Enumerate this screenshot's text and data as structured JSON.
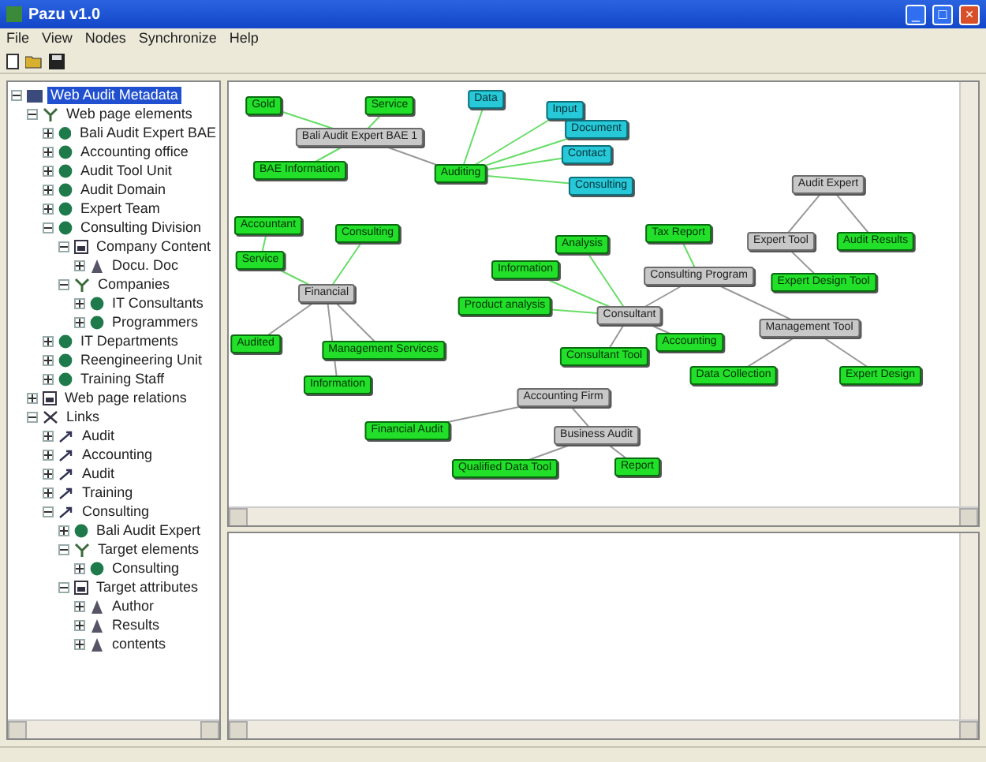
{
  "window": {
    "title": "Pazu v1.0",
    "controls": [
      "_",
      "□",
      "×"
    ]
  },
  "menu": [
    "File",
    "View",
    "Nodes",
    "Synchronize",
    "Help"
  ],
  "tree": [
    {
      "label": "Web Audit Metadata",
      "kind": "root",
      "selected": true,
      "expanded": true,
      "children": [
        {
          "label": "Web page elements",
          "kind": "type",
          "selected": false,
          "expanded": true,
          "children": [
            {
              "label": "Bali Audit Expert BAE",
              "kind": "entity",
              "selected": false,
              "expanded": false
            },
            {
              "label": "Accounting office",
              "kind": "entity",
              "selected": false,
              "expanded": false
            },
            {
              "label": "Audit Tool Unit",
              "kind": "entity",
              "selected": false,
              "expanded": false
            },
            {
              "label": "Audit Domain",
              "kind": "entity",
              "selected": false,
              "expanded": false
            },
            {
              "label": "Expert Team",
              "kind": "entity",
              "selected": false,
              "expanded": false
            },
            {
              "label": "Consulting Division",
              "kind": "entity",
              "selected": false,
              "expanded": true,
              "children": [
                {
                  "label": "Company Content",
                  "kind": "group",
                  "selected": false,
                  "expanded": true,
                  "children": [
                    {
                      "label": "Docu. Doc",
                      "kind": "attr",
                      "selected": false,
                      "expanded": false
                    }
                  ]
                },
                {
                  "label": "Companies",
                  "kind": "type",
                  "selected": false,
                  "expanded": true,
                  "children": [
                    {
                      "label": "IT Consultants",
                      "kind": "entity",
                      "selected": false,
                      "expanded": false
                    },
                    {
                      "label": "Programmers",
                      "kind": "entity",
                      "selected": false,
                      "expanded": false
                    }
                  ]
                }
              ]
            },
            {
              "label": "IT Departments",
              "kind": "entity",
              "selected": false,
              "expanded": false
            },
            {
              "label": "Reengineering Unit",
              "kind": "entity",
              "selected": false,
              "expanded": false
            },
            {
              "label": "Training Staff",
              "kind": "entity",
              "selected": false,
              "expanded": false
            }
          ]
        },
        {
          "label": "Web page relations",
          "kind": "group",
          "selected": false,
          "expanded": false
        },
        {
          "label": "Links",
          "kind": "links",
          "selected": false,
          "expanded": true,
          "children": [
            {
              "label": "Audit",
              "kind": "link",
              "selected": false,
              "expanded": false
            },
            {
              "label": "Accounting",
              "kind": "link",
              "selected": false,
              "expanded": false
            },
            {
              "label": "Audit",
              "kind": "link",
              "selected": false,
              "expanded": false
            },
            {
              "label": "Training",
              "kind": "link",
              "selected": false,
              "expanded": false
            },
            {
              "label": "Consulting",
              "kind": "link",
              "selected": false,
              "expanded": true,
              "children": [
                {
                  "label": "Bali Audit Expert",
                  "kind": "entity",
                  "selected": false,
                  "expanded": false
                },
                {
                  "label": "Target elements",
                  "kind": "type",
                  "selected": false,
                  "expanded": true,
                  "children": [
                    {
                      "label": "Consulting",
                      "kind": "entity",
                      "selected": false,
                      "expanded": false
                    }
                  ]
                },
                {
                  "label": "Target attributes",
                  "kind": "group",
                  "selected": false,
                  "expanded": true,
                  "children": [
                    {
                      "label": "Author",
                      "kind": "attr",
                      "selected": false,
                      "expanded": false
                    },
                    {
                      "label": "Results",
                      "kind": "attr",
                      "selected": false,
                      "expanded": false
                    },
                    {
                      "label": "contents",
                      "kind": "attr",
                      "selected": false,
                      "expanded": false
                    }
                  ]
                }
              ]
            }
          ]
        }
      ]
    }
  ],
  "graph": {
    "nodes": [
      {
        "label": "Gold",
        "kind": "element"
      },
      {
        "label": "Service",
        "kind": "element"
      },
      {
        "label": "Bali Audit Expert BAE 1",
        "kind": "class"
      },
      {
        "label": "BAE Information",
        "kind": "element"
      },
      {
        "label": "Auditing",
        "kind": "element"
      },
      {
        "label": "Data",
        "kind": "attribute"
      },
      {
        "label": "Input",
        "kind": "attribute"
      },
      {
        "label": "Document",
        "kind": "attribute"
      },
      {
        "label": "Contact",
        "kind": "attribute"
      },
      {
        "label": "Consulting",
        "kind": "attribute"
      },
      {
        "label": "Audit Expert",
        "kind": "class"
      },
      {
        "label": "Expert Tool",
        "kind": "class"
      },
      {
        "label": "Audit Results",
        "kind": "element"
      },
      {
        "label": "Expert Design Tool",
        "kind": "element"
      },
      {
        "label": "Tax Report",
        "kind": "element"
      },
      {
        "label": "Analysis",
        "kind": "element"
      },
      {
        "label": "Information",
        "kind": "element"
      },
      {
        "label": "Consulting Program",
        "kind": "class"
      },
      {
        "label": "Product analysis",
        "kind": "element"
      },
      {
        "label": "Consultant",
        "kind": "class"
      },
      {
        "label": "Accounting",
        "kind": "element"
      },
      {
        "label": "Management Tool",
        "kind": "class"
      },
      {
        "label": "Expert Design",
        "kind": "element"
      },
      {
        "label": "Consultant Tool",
        "kind": "element"
      },
      {
        "label": "Data Collection",
        "kind": "element"
      },
      {
        "label": "Accountant",
        "kind": "element"
      },
      {
        "label": "Service",
        "kind": "element"
      },
      {
        "label": "Consulting",
        "kind": "element"
      },
      {
        "label": "Financial",
        "kind": "class"
      },
      {
        "label": "Audited",
        "kind": "element"
      },
      {
        "label": "Management Services",
        "kind": "element"
      },
      {
        "label": "Information",
        "kind": "element"
      },
      {
        "label": "Accounting Firm",
        "kind": "class"
      },
      {
        "label": "Financial Audit",
        "kind": "element"
      },
      {
        "label": "Business Audit",
        "kind": "class"
      },
      {
        "label": "Qualified Data Tool",
        "kind": "element"
      },
      {
        "label": "Report",
        "kind": "element"
      }
    ]
  }
}
